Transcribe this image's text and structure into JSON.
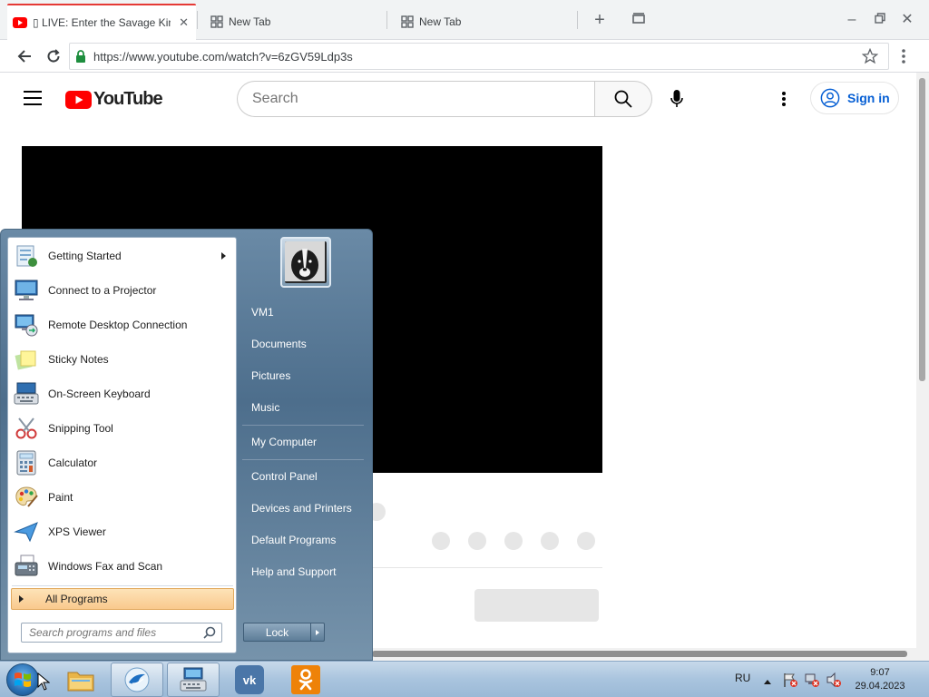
{
  "browser": {
    "tabs": [
      {
        "label": "▯ LIVE: Enter the Savage King",
        "icon": "youtube-favicon",
        "active": true
      },
      {
        "label": "New Tab",
        "icon": "new-tab-grid-icon",
        "active": false
      },
      {
        "label": "New Tab",
        "icon": "new-tab-grid-icon",
        "active": false
      }
    ],
    "url": "https://www.youtube.com/watch?v=6zGV59Ldp3s"
  },
  "youtube": {
    "logo_text": "YouTube",
    "search_placeholder": "Search",
    "signin_label": "Sign in"
  },
  "start_menu": {
    "programs": [
      {
        "label": "Getting Started",
        "icon": "getting-started-icon",
        "has_submenu": true
      },
      {
        "label": "Connect to a Projector",
        "icon": "projector-icon",
        "has_submenu": false
      },
      {
        "label": "Remote Desktop Connection",
        "icon": "remote-desktop-icon",
        "has_submenu": false
      },
      {
        "label": "Sticky Notes",
        "icon": "sticky-notes-icon",
        "has_submenu": false
      },
      {
        "label": "On-Screen Keyboard",
        "icon": "keyboard-icon",
        "has_submenu": false
      },
      {
        "label": "Snipping Tool",
        "icon": "scissors-icon",
        "has_submenu": false
      },
      {
        "label": "Calculator",
        "icon": "calculator-icon",
        "has_submenu": false
      },
      {
        "label": "Paint",
        "icon": "paint-palette-icon",
        "has_submenu": false
      },
      {
        "label": "XPS Viewer",
        "icon": "xps-viewer-icon",
        "has_submenu": false
      },
      {
        "label": "Windows Fax and Scan",
        "icon": "fax-icon",
        "has_submenu": false
      }
    ],
    "all_programs": "All Programs",
    "search_placeholder": "Search programs and files",
    "right_items": [
      "VM1",
      "Documents",
      "Pictures",
      "Music",
      "My Computer",
      "Control Panel",
      "Devices and Printers",
      "Default Programs",
      "Help and Support"
    ],
    "lock_label": "Lock"
  },
  "taskbar": {
    "language": "RU",
    "time": "9:07",
    "date": "29.04.2023",
    "apps": [
      "file-explorer-icon",
      "bird-app-icon",
      "keyboard-app-icon",
      "vk-icon",
      "odnoklassniki-icon"
    ]
  },
  "colors": {
    "youtube_red": "#ff0000",
    "tab_accent": "#e53935",
    "signin_blue": "#065fd4",
    "lock_green": "#1e8e3e",
    "vk_blue": "#4a76a8",
    "ok_orange": "#ee8208"
  }
}
